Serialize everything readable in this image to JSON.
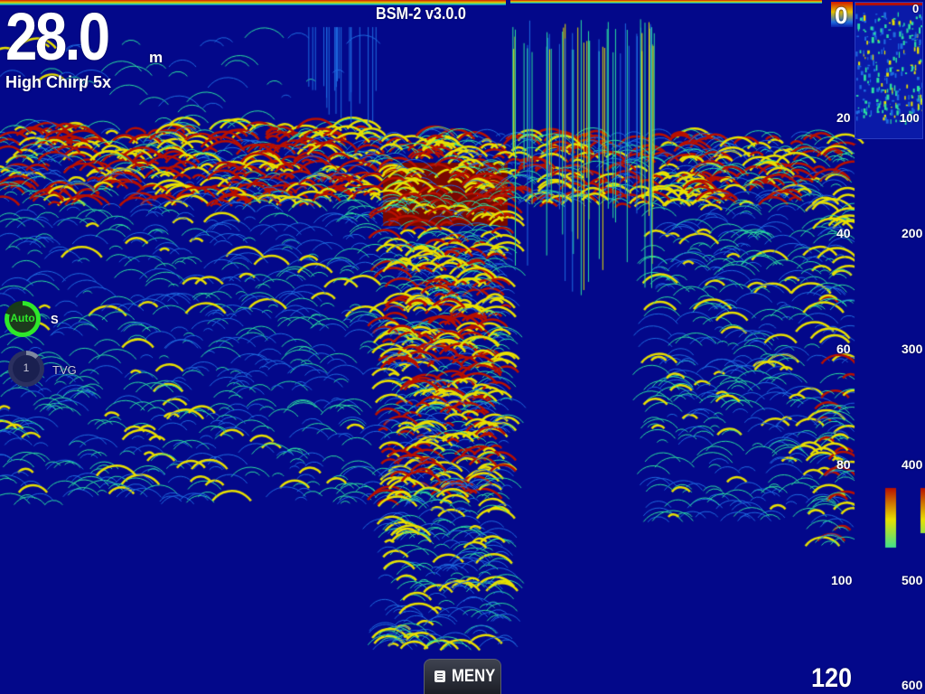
{
  "app_title": "BSM-2 v3.0.0",
  "depth": {
    "value": "28.0",
    "unit": "m"
  },
  "mode": {
    "label": "High Chirp",
    "zoom": "/ 5x"
  },
  "range_start": "0",
  "range_end": "120",
  "depth_scale_mid": [
    "20",
    "40",
    "60",
    "80",
    "100"
  ],
  "depth_scale_right": [
    "200",
    "300",
    "400",
    "500",
    "600"
  ],
  "mini_view": {
    "top_label": "0",
    "bottom_label": "100"
  },
  "controls": {
    "auto": {
      "label": "Auto",
      "value": "S"
    },
    "tvg": {
      "value": "1",
      "label": "TVG"
    }
  },
  "menu": {
    "label": "MENY"
  },
  "colors": {
    "background": "#03088a",
    "strong_echo": "#b81000",
    "medium_echo": "#e8e000",
    "weak_echo": "#2be0a0",
    "faint_echo": "#1e6be0",
    "auto_indicator": "#2ee82a"
  },
  "icons": {
    "menu": "menu-list-icon"
  }
}
